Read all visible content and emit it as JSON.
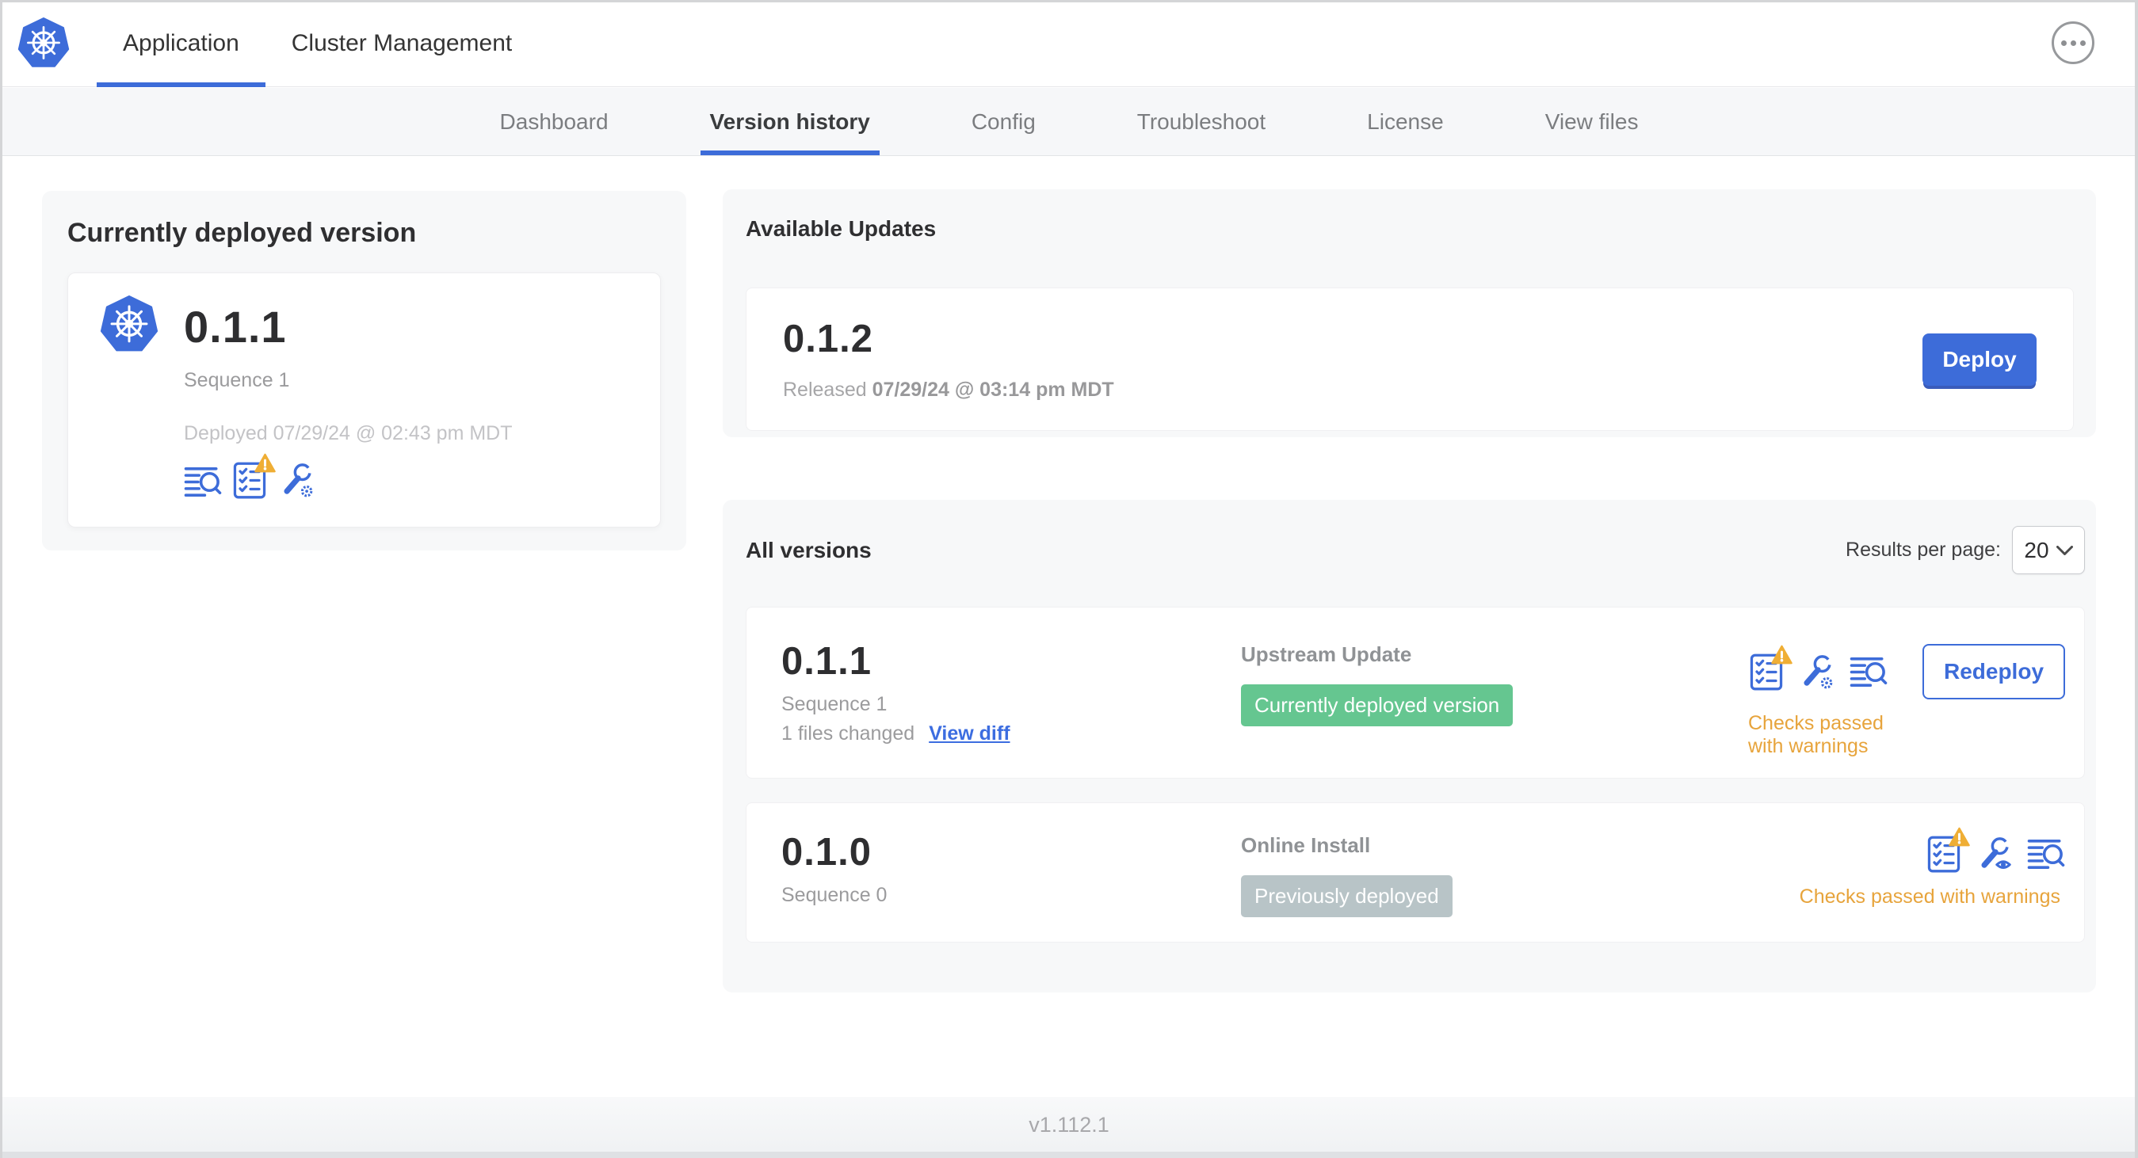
{
  "header": {
    "tabs": [
      {
        "label": "Application",
        "active": true
      },
      {
        "label": "Cluster Management",
        "active": false
      }
    ]
  },
  "subnav": {
    "tabs": [
      {
        "label": "Dashboard",
        "active": false
      },
      {
        "label": "Version history",
        "active": true
      },
      {
        "label": "Config",
        "active": false
      },
      {
        "label": "Troubleshoot",
        "active": false
      },
      {
        "label": "License",
        "active": false
      },
      {
        "label": "View files",
        "active": false
      }
    ]
  },
  "current_version": {
    "title": "Currently deployed version",
    "version": "0.1.1",
    "sequence": "Sequence 1",
    "deployed": "Deployed 07/29/24 @ 02:43 pm MDT",
    "icons": [
      "deploy-logs-icon",
      "preflight-checks-warning-icon",
      "edit-config-icon"
    ]
  },
  "available_updates": {
    "title": "Available Updates",
    "version": "0.1.2",
    "released_prefix": "Released",
    "released_date": "07/29/24 @ 03:14 pm MDT",
    "deploy_label": "Deploy"
  },
  "all_versions": {
    "title": "All versions",
    "results_per_page_label": "Results per page:",
    "results_per_page_value": "20",
    "rows": [
      {
        "version": "0.1.1",
        "sequence": "Sequence 1",
        "files_changed": "1 files changed",
        "view_diff_label": "View diff",
        "source": "Upstream Update",
        "badge_label": "Currently deployed version",
        "badge_color": "#65c690",
        "action_label": "Redeploy",
        "status": "Checks passed with warnings",
        "icons": [
          "preflight-checks-warning-icon",
          "edit-config-icon",
          "deploy-logs-icon"
        ]
      },
      {
        "version": "0.1.0",
        "sequence": "Sequence 0",
        "source": "Online Install",
        "badge_label": "Previously deployed",
        "badge_color": "#b8c4c7",
        "status": "Checks passed with warnings",
        "icons": [
          "preflight-checks-warning-icon",
          "view-config-icon",
          "deploy-logs-icon"
        ]
      }
    ]
  },
  "footer": {
    "app_version": "v1.112.1"
  },
  "colors": {
    "accent_blue": "#3d6cd9",
    "green_badge": "#65c690",
    "gray_badge": "#b8c4c7",
    "warning_text": "#e7a43c",
    "warning_triangle": "#efae35",
    "subnav_bg": "#f6f7f9",
    "panel_bg": "#f7f8f9"
  }
}
